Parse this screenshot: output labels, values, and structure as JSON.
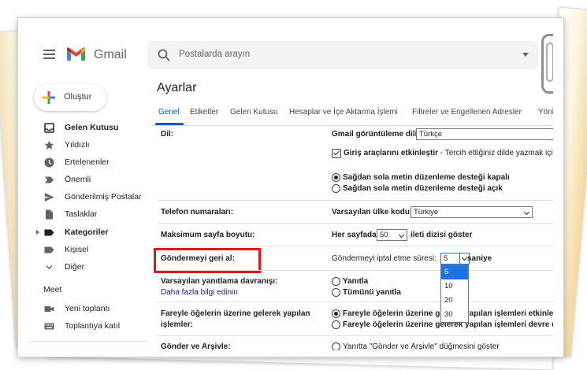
{
  "app": {
    "name": "Gmail"
  },
  "search": {
    "placeholder": "Postalarda arayın"
  },
  "sidebar": {
    "compose": "Oluştur",
    "items": [
      {
        "label": "Gelen Kutusu",
        "icon": "inbox-icon",
        "bold": true
      },
      {
        "label": "Yıldızlı",
        "icon": "star-icon",
        "bold": false
      },
      {
        "label": "Ertelenenler",
        "icon": "clock-icon",
        "bold": false
      },
      {
        "label": "Önemli",
        "icon": "important-icon",
        "bold": false
      },
      {
        "label": "Gönderilmiş Postalar",
        "icon": "send-icon",
        "bold": false
      },
      {
        "label": "Taslaklar",
        "icon": "draft-icon",
        "bold": false
      },
      {
        "label": "Kategoriler",
        "icon": "label-icon",
        "bold": true
      },
      {
        "label": "Kişisel",
        "icon": "label-icon",
        "bold": false
      },
      {
        "label": "Diğer",
        "icon": "chevron-down-icon",
        "bold": false
      }
    ],
    "meet": {
      "heading": "Meet",
      "items": [
        {
          "label": "Yeni toplantı",
          "icon": "video-icon"
        },
        {
          "label": "Toplantıya katıl",
          "icon": "keyboard-icon"
        }
      ]
    }
  },
  "settings": {
    "title": "Ayarlar",
    "tabs": [
      {
        "label": "Genel",
        "active": true
      },
      {
        "label": "Etiketler",
        "active": false
      },
      {
        "label": "Gelen Kutusu",
        "active": false
      },
      {
        "label": "Hesaplar ve İçe Aktarma İşlemi",
        "active": false
      },
      {
        "label": "Filtreler ve Engellenen Adresler",
        "active": false
      },
      {
        "label": "Yönl",
        "active": false
      }
    ],
    "language": {
      "label": "Dil:",
      "display_label": "Gmail görüntüleme dili:",
      "display_value": "Türkçe",
      "input_tools_label": "Giriş araçlarını etkinleştir",
      "input_tools_desc": " - Tercih ettiğiniz dilde yazmak için",
      "rtl_off": "Sağdan sola metin düzenleme desteği kapalı",
      "rtl_on": "Sağdan sola metin düzenleme desteği açık"
    },
    "phone": {
      "label": "Telefon numaraları:",
      "country_label": "Varsayılan ülke kodu:",
      "country_value": "Türkiye"
    },
    "page_size": {
      "label": "Maksimum sayfa boyutu:",
      "prefix": "Her sayfada",
      "value": "50",
      "suffix": "ileti dizisi göster"
    },
    "undo_send": {
      "label": "Göndermeyi geri al:",
      "period_label": "Göndermeyi iptal etme süresi:",
      "value": "5",
      "unit": "saniye",
      "options": [
        "5",
        "10",
        "20",
        "30"
      ]
    },
    "reply": {
      "label": "Varsayılan yanıtlama davranışı:",
      "link": "Daha fazla bilgi edinin",
      "opt_reply": "Yanıtla",
      "opt_reply_all": "Tümünü yanıtla"
    },
    "hover": {
      "label_line1": "Fareyle öğelerin üzerine gelerek yapılan",
      "label_line2": "işlemler:",
      "opt_enable": "Fareyle öğelerin üzerine gelerek yapılan işlemleri etkinleştir",
      "opt_disable": "Fareyle öğelerin üzerine gelerek yapılan işlemleri devre dışı"
    },
    "send_archive": {
      "label": "Gönder ve Arşivle:",
      "option": "Yanıtta \"Gönder ve Arşivle\" düğmesini göster"
    }
  },
  "colors": {
    "accent": "#0b57d0",
    "highlight": "#e0181b",
    "selected_option": "#1a73e8"
  }
}
